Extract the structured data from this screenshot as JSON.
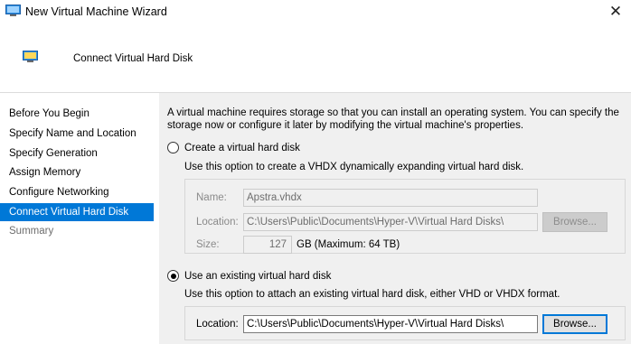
{
  "window": {
    "title": "New Virtual Machine Wizard",
    "close_glyph": "✕",
    "icon": "vm-monitor-icon"
  },
  "header": {
    "title": "Connect Virtual Hard Disk",
    "icon": "vm-monitor-icon"
  },
  "sidebar": {
    "items": [
      {
        "label": "Before You Begin",
        "state": "normal"
      },
      {
        "label": "Specify Name and Location",
        "state": "normal"
      },
      {
        "label": "Specify Generation",
        "state": "normal"
      },
      {
        "label": "Assign Memory",
        "state": "normal"
      },
      {
        "label": "Configure Networking",
        "state": "normal"
      },
      {
        "label": "Connect Virtual Hard Disk",
        "state": "selected"
      },
      {
        "label": "Summary",
        "state": "disabled"
      }
    ]
  },
  "main": {
    "intro": "A virtual machine requires storage so that you can install an operating system. You can specify the storage now or configure it later by modifying the virtual machine's properties.",
    "create_option": {
      "label": "Create a virtual hard disk",
      "selected": false,
      "description": "Use this option to create a VHDX dynamically expanding virtual hard disk.",
      "name_label": "Name:",
      "name_value": "Apstra.vhdx",
      "location_label": "Location:",
      "location_value": "C:\\Users\\Public\\Documents\\Hyper-V\\Virtual Hard Disks\\",
      "browse_label": "Browse...",
      "size_label": "Size:",
      "size_value": "127",
      "size_unit": "GB (Maximum: 64 TB)"
    },
    "existing_option": {
      "label": "Use an existing virtual hard disk",
      "selected": true,
      "description": "Use this option to attach an existing virtual hard disk, either VHD or VHDX format.",
      "location_label": "Location:",
      "location_value": "C:\\Users\\Public\\Documents\\Hyper-V\\Virtual Hard Disks\\",
      "browse_label": "Browse..."
    }
  },
  "colors": {
    "selected_nav": "#0078d7",
    "panel_bg": "#f0f0f0"
  }
}
